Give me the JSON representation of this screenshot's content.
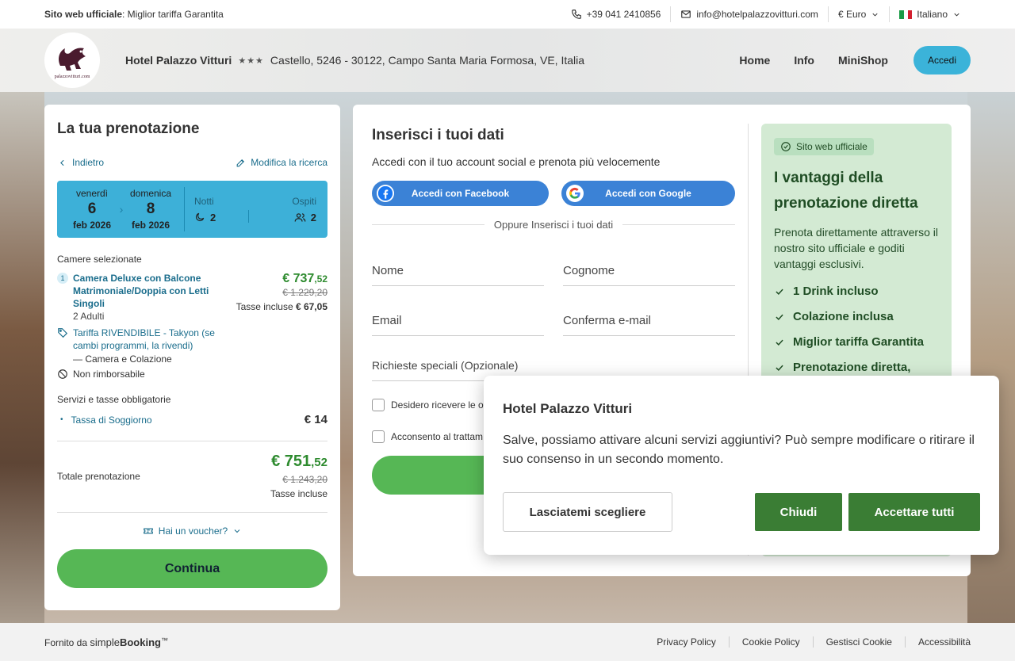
{
  "topbar": {
    "official_bold": "Sito web ufficiale",
    "official_rest": ": Miglior tariffa Garantita",
    "phone": "+39 041 2410856",
    "email": "info@hotelpalazzovitturi.com",
    "currency": "€ Euro",
    "language": "Italiano"
  },
  "header": {
    "logo_text": "palazzovitturi.com",
    "hotel_name": "Hotel Palazzo Vitturi",
    "stars": "★★★",
    "address": "Castello, 5246 - 30122, Campo Santa Maria Formosa, VE, Italia",
    "nav": [
      "Home",
      "Info",
      "MiniShop"
    ],
    "login": "Accedi"
  },
  "booking": {
    "title": "La tua prenotazione",
    "back": "Indietro",
    "modify": "Modifica la ricerca",
    "checkin": {
      "weekday": "venerdì",
      "day": "6",
      "month": "feb 2026"
    },
    "checkout": {
      "weekday": "domenica",
      "day": "8",
      "month": "feb 2026"
    },
    "nights_label": "Notti",
    "nights": "2",
    "guests_label": "Ospiti",
    "guests": "2",
    "rooms_title": "Camere selezionate",
    "room": {
      "index": "1",
      "name": "Camera Deluxe con Balcone Matrimoniale/Doppia con Letti Singoli",
      "adults": "2 Adulti",
      "price_int": "€ 737",
      "price_dec": ",52",
      "price_old": "€ 1.229,20",
      "tax_label": "Tasse incluse ",
      "tax_value": "€ 67,05",
      "tariff": "Tariffa RIVENDIBILE - Takyon (se cambi programmi, la rivendi)",
      "board": "— Camera e Colazione",
      "refund": "Non rimborsabile"
    },
    "services_title": "Servizi e tasse obbligatorie",
    "city_tax_label": "Tassa di Soggiorno",
    "city_tax_value": "€ 14",
    "total_label": "Totale prenotazione",
    "total_int": "€ 751",
    "total_dec": ",52",
    "total_old": "€ 1.243,20",
    "total_tax": "Tasse incluse",
    "voucher": "Hai un voucher?",
    "continue": "Continua"
  },
  "form": {
    "title": "Inserisci i tuoi dati",
    "subtitle": "Accedi con il tuo account social e prenota più velocemente",
    "facebook": "Accedi con Facebook",
    "google": "Accedi con Google",
    "or_text": "Oppure Inserisci i tuoi dati",
    "first_name": "Nome",
    "last_name": "Cognome",
    "email": "Email",
    "confirm_email": "Conferma e-mail",
    "special": "Richieste speciali (Opzionale)",
    "check1": "Desidero ricevere le of",
    "check2": "Acconsento al trattam"
  },
  "benefits": {
    "badge": "Sito web ufficiale",
    "title": "I vantaggi della prenotazione diretta",
    "desc": "Prenota direttamente attraverso il nostro sito ufficiale e goditi vantaggi esclusivi.",
    "items": [
      "1 Drink incluso",
      "Colazione inclusa",
      "Miglior tariffa Garantita",
      "Prenotazione diretta,"
    ]
  },
  "cookie": {
    "title": "Hotel Palazzo Vitturi",
    "text": "Salve, possiamo attivare alcuni servizi aggiuntivi? Può sempre modificare o ritirare il suo consenso in un secondo momento.",
    "choose": "Lasciatemi scegliere",
    "close": "Chiudi",
    "accept": "Accettare tutti"
  },
  "footer": {
    "powered": "Fornito da ",
    "brand_simple": "simple",
    "brand_booking": "Booking",
    "tm": "™",
    "links": [
      "Privacy Policy",
      "Cookie Policy",
      "Gestisci Cookie",
      "Accessibilità"
    ]
  },
  "colors": {
    "accent_blue": "#3db0d8",
    "green_button": "#56b755",
    "cookie_green": "#3a7d34",
    "benefit_bg": "#d3ead3"
  }
}
